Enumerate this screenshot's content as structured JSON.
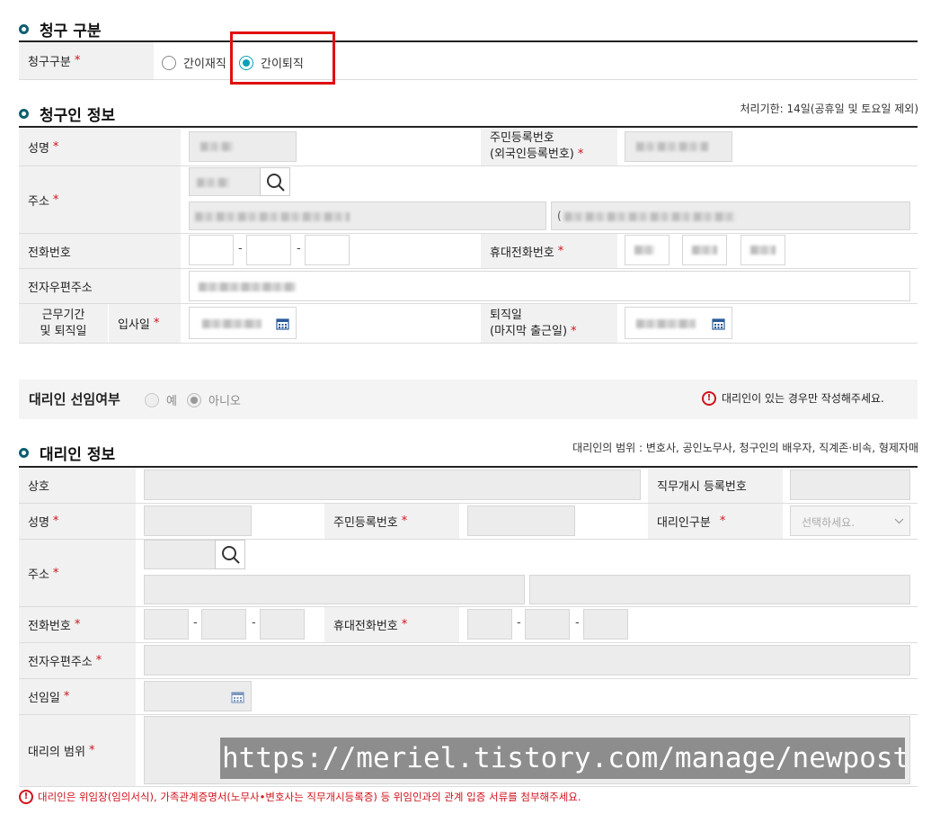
{
  "claim_type": {
    "title": "청구 구분",
    "label": "청구구분",
    "options": [
      "간이재직",
      "간이퇴직"
    ],
    "selected": "간이퇴직"
  },
  "claimant": {
    "title": "청구인 정보",
    "deadline_note": "처리기한: 14일(공휴일 및 토요일 제외)",
    "name_label": "성명",
    "rrn_label_1": "주민등록번호",
    "rrn_label_2": "(외국인등록번호)",
    "address_label": "주소",
    "address_detail_prefix": "(",
    "phone_label": "전화번호",
    "mobile_label": "휴대전화번호",
    "email_label": "전자우편주소",
    "work_period_label_1": "근무기간",
    "work_period_label_2": "및 퇴직일",
    "hire_date_label": "입사일",
    "retire_label_1": "퇴직일",
    "retire_label_2": "(마지막 출근일)"
  },
  "agent_select": {
    "label": "대리인 선임여부",
    "options": [
      "예",
      "아니오"
    ],
    "selected": "아니오",
    "notice": "대리인이 있는 경우만 작성해주세요."
  },
  "agent": {
    "title": "대리인 정보",
    "scope_note": "대리인의 범위 : 변호사, 공인노무사, 청구인의 배우자, 직계존·비속, 형제자매",
    "company_label": "상호",
    "registration_label": "직무개시 등록번호",
    "name_label": "성명",
    "rrn_label": "주민등록번호",
    "agent_type_label": "대리인구분",
    "agent_type_placeholder": "선택하세요.",
    "address_label": "주소",
    "phone_label": "전화번호",
    "mobile_label": "휴대전화번호",
    "email_label": "전자우편주소",
    "appoint_date_label": "선임일",
    "scope_label": "대리의 범위"
  },
  "footer_notice": "대리인은 위임장(임의서식), 가족관계증명서(노무사•변호사는 직무개시등록증) 등 위임인과의 관계 입증 서류를 첨부해주세요.",
  "dash": "-",
  "required_mark": "*",
  "watermark_text": "https://meriel.tistory.com/manage/newpost/?type=po",
  "colors": {
    "accent": "#0aa1b8",
    "section_dot": "#0b5f6e",
    "required": "#d0121b",
    "highlight_box": "#e01010"
  }
}
